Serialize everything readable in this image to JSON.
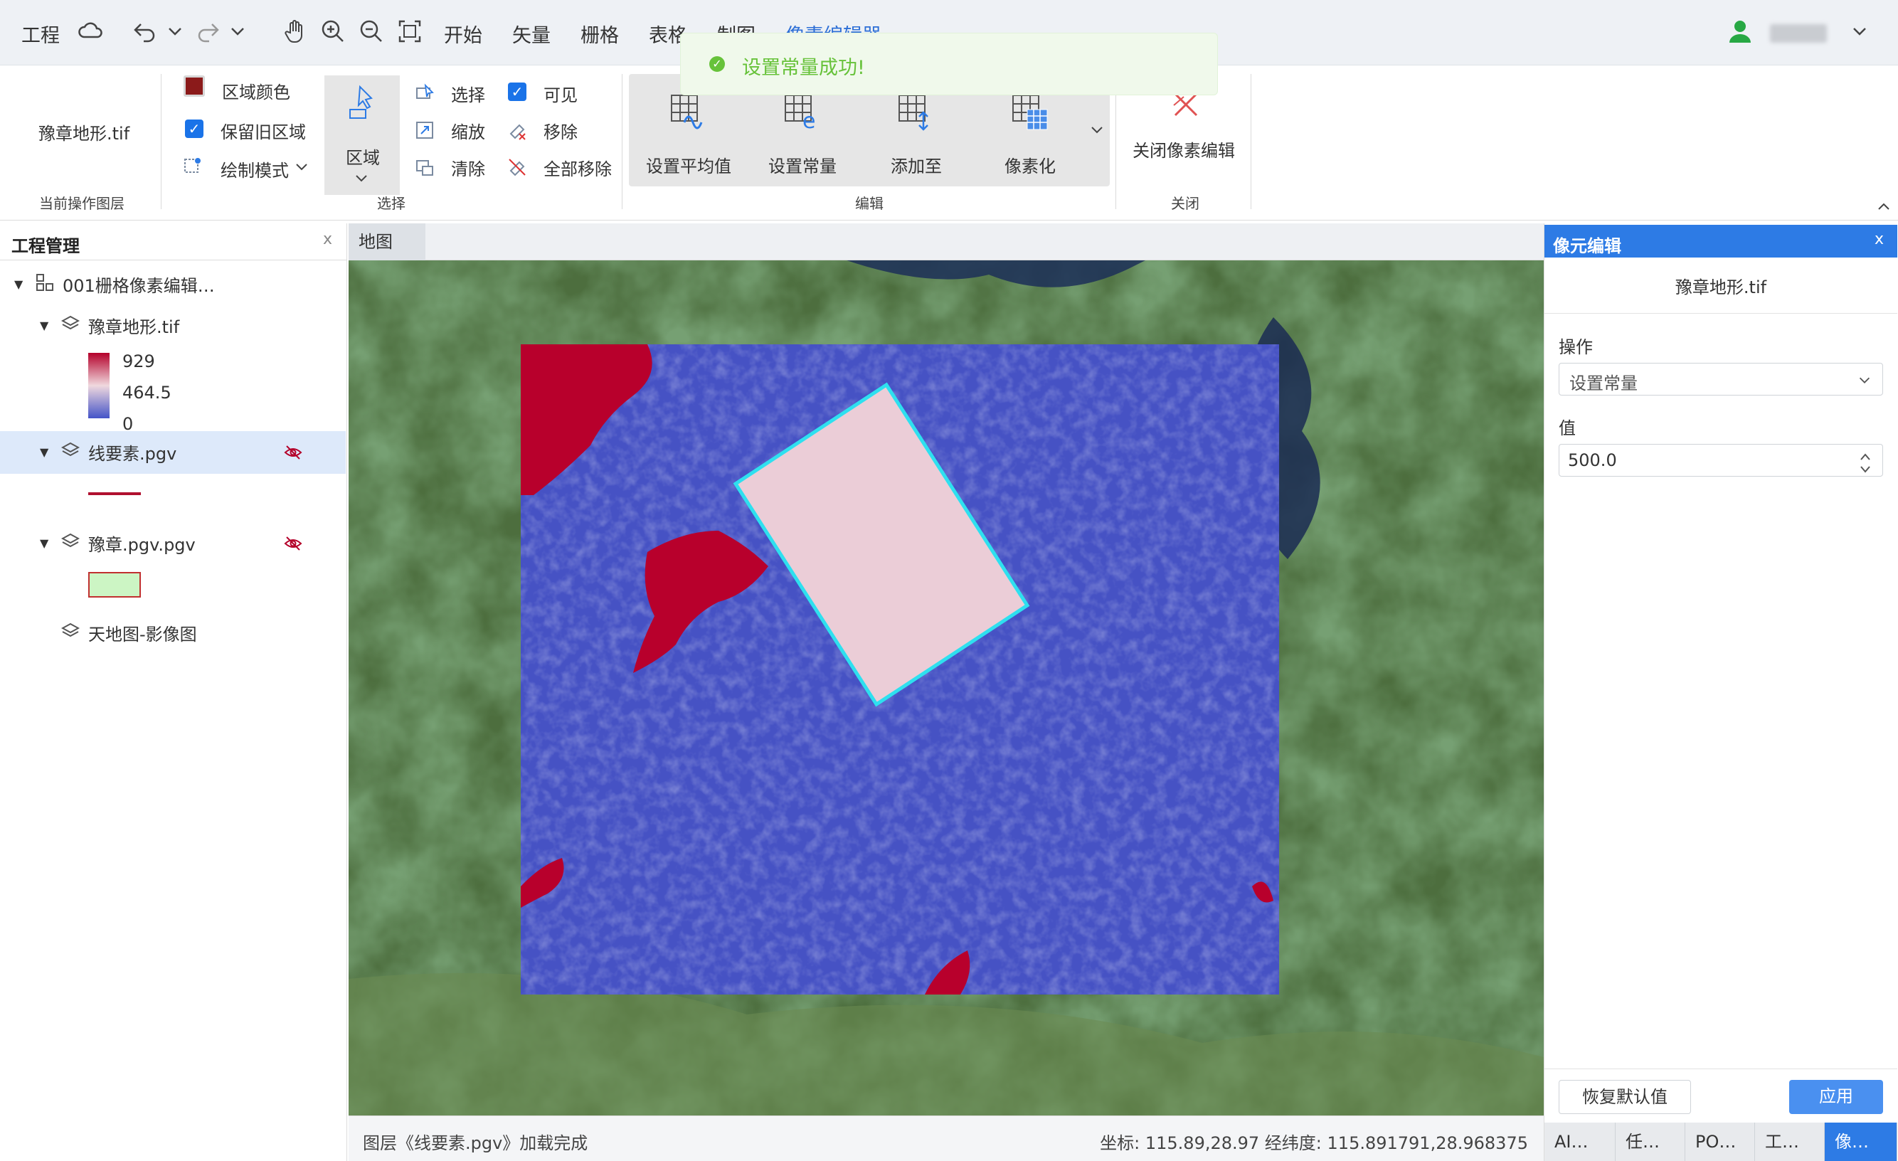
{
  "menu": {
    "project": "工程",
    "tabs": [
      "开始",
      "矢量",
      "栅格",
      "表格",
      "制图"
    ],
    "active_tab": "像素编辑器",
    "username": "用户名"
  },
  "ribbon": {
    "current_layer": "豫章地形.tif",
    "current_layer_group": "当前操作图层",
    "region_color": "区域颜色",
    "keep_old_region": "保留旧区域",
    "draw_mode": "绘制模式",
    "region": "区域",
    "select": "选择",
    "zoom": "缩放",
    "clear": "清除",
    "visible": "可见",
    "remove": "移除",
    "remove_all": "全部移除",
    "select_group": "选择",
    "set_mean": "设置平均值",
    "set_constant": "设置常量",
    "add_to": "添加至",
    "pixelize": "像素化",
    "edit_group": "编辑",
    "close_pixel_edit": "关闭像素编辑",
    "close_group": "关闭"
  },
  "toast": {
    "message": "设置常量成功!",
    "color": "#67c23a"
  },
  "project_panel": {
    "title": "工程管理",
    "close": "x",
    "root": "001栅格像素编辑…",
    "layers": [
      {
        "name": "豫章地形.tif"
      },
      {
        "name": "线要素.pgv"
      },
      {
        "name": "豫章.pgv.pgv"
      },
      {
        "name": "天地图-影像图"
      }
    ],
    "legend": {
      "max": "929",
      "mid": "464.5",
      "min": "0"
    }
  },
  "map": {
    "tab": "地图",
    "status": "图层《线要素.pgv》加载完成",
    "coords": "坐标: 115.89,28.97 经纬度: 115.891791,28.968375"
  },
  "pixel_panel": {
    "title": "像元编辑",
    "close": "x",
    "layer": "豫章地形.tif",
    "operation_label": "操作",
    "operation_value": "设置常量",
    "value_label": "值",
    "value": "500.0",
    "reset_button": "恢复默认值",
    "apply_button": "应用",
    "accent": "#2d7be5"
  },
  "bottom_tabs": [
    "AI…",
    "任…",
    "PO…",
    "工…",
    "像…"
  ]
}
